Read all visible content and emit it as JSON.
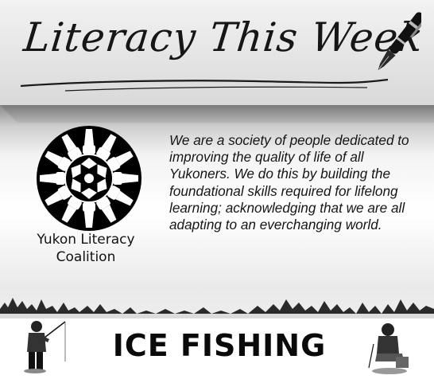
{
  "banner": {
    "title": "Literacy This Week",
    "pen_icon": "fountain-pen-icon"
  },
  "organization": {
    "name_line1": "Yukon Literacy",
    "name_line2": "Coalition",
    "logo_icon": "hands-and-books-circle-logo"
  },
  "mission": {
    "text": "We are a society of people dedicated to improving the quality of life of all Yukoners. We do this by building the foundational skills required for lifelong learning; acknowledging that we are all adapting to an everchanging world."
  },
  "feature": {
    "headline": "ICE FISHING",
    "left_icon": "ice-fisherman-standing-icon",
    "right_icon": "ice-fisherman-sitting-icon"
  },
  "colors": {
    "text": "#161616",
    "banner_bg": "#e0e0e0",
    "fold": "#8c8c8c"
  }
}
